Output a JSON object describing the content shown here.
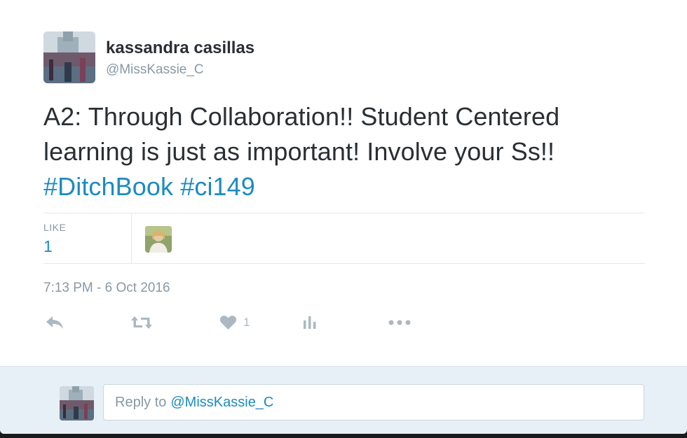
{
  "tweet": {
    "author": {
      "display_name": "kassandra casillas",
      "handle": "@MissKassie_C"
    },
    "text": "A2: Through Collaboration!! Student Centered learning is just as important! Involve your Ss!!",
    "hashtags": [
      "#DitchBook",
      "#ci149"
    ],
    "stats": {
      "like_label": "LIKE",
      "like_count": "1"
    },
    "timestamp": "7:13 PM - 6 Oct 2016",
    "actions": {
      "reply_icon": "reply-icon",
      "retweet_icon": "retweet-icon",
      "like_icon": "heart-icon",
      "like_count": "1",
      "analytics_icon": "analytics-icon",
      "more_icon": "more-icon"
    }
  },
  "reply_box": {
    "prefix": "Reply to",
    "mention": "@MissKassie_C"
  },
  "colors": {
    "link": "#1c8bbf",
    "text": "#292f33",
    "muted": "#8899a6",
    "icon": "#aab8c2",
    "reply_background": "#e8f0f7"
  }
}
